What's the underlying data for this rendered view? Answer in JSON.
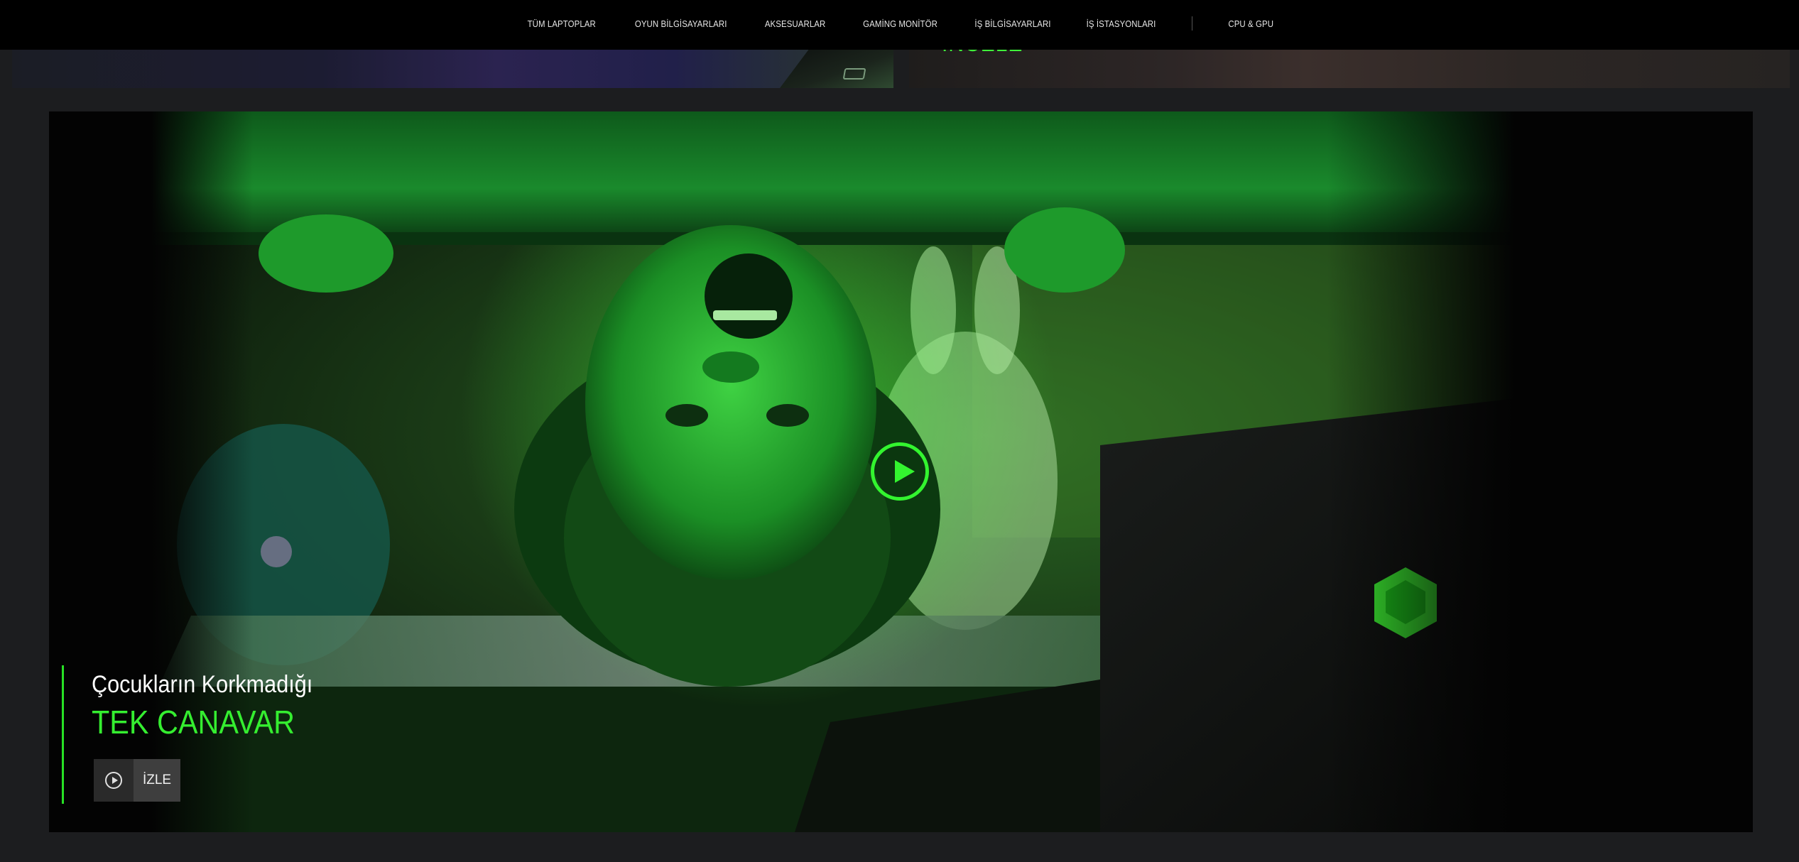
{
  "nav": {
    "items": [
      {
        "label": "TÜM LAPTOPLAR"
      },
      {
        "label": "OYUN BİLGİSAYARLARI"
      },
      {
        "label": "AKSESUARLAR"
      },
      {
        "label": "GAMİNG MONİTÖR"
      },
      {
        "label": "İŞ BİLGİSAYARLARI"
      },
      {
        "label": "İŞ İSTASYONLARI"
      },
      {
        "label": "CPU & GPU"
      }
    ]
  },
  "top_cards": {
    "right_link": "İNCELE"
  },
  "hero": {
    "subtitle": "Çocukların Korkmadığı",
    "title": "TEK CANAVAR",
    "watch_label": "İZLE",
    "accent_color": "#33f52f"
  },
  "icons": {
    "play": "play-circle-icon",
    "watch": "play-outline-icon"
  }
}
